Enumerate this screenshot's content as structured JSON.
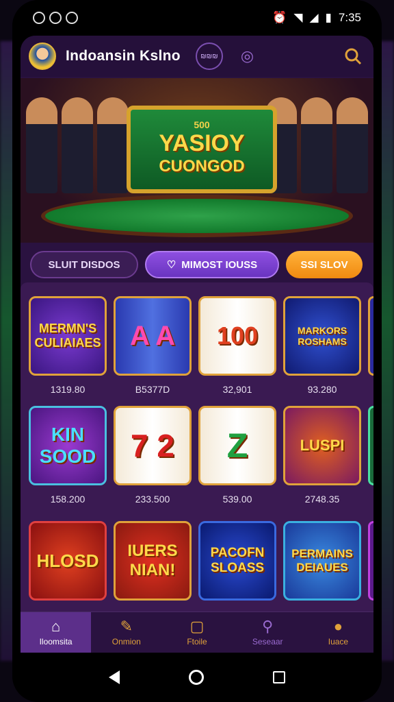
{
  "status": {
    "time": "7:35"
  },
  "app": {
    "title": "Indoansin Kslno",
    "pill_icon_text": "₪₪₪"
  },
  "banner": {
    "line1": "500",
    "line2": "YASIOY",
    "line3": "CUONGOD"
  },
  "tabs": [
    {
      "label": "SLUIT DISDOS"
    },
    {
      "label": "MIMOST IOUSS"
    },
    {
      "label": "SSI SLOV"
    }
  ],
  "games": [
    [
      {
        "name": "MERMN'S CULIAIAES",
        "price": "1319.80"
      },
      {
        "name": "A A",
        "price": "B5377D"
      },
      {
        "name": "100",
        "price": "32,901"
      },
      {
        "name": "MARKORS ROSHAMS",
        "price": "93.280"
      }
    ],
    [
      {
        "name": "KIN SOOD",
        "price": "158.200"
      },
      {
        "name": "7 2",
        "price": "233.500"
      },
      {
        "name": "Z",
        "price": "539.00"
      },
      {
        "name": "LUSPI",
        "price": "2748.35"
      }
    ],
    [
      {
        "name": "HLOSD",
        "price": ""
      },
      {
        "name": "IUERS NIAN!",
        "price": ""
      },
      {
        "name": "PACOFN SLOASS",
        "price": ""
      },
      {
        "name": "PERMAINS DEIAUES",
        "price": ""
      }
    ]
  ],
  "nav": [
    {
      "label": "Iloomsita",
      "icon": "home-icon"
    },
    {
      "label": "Onmion",
      "icon": "microphone-icon"
    },
    {
      "label": "Ftoile",
      "icon": "square-icon"
    },
    {
      "label": "Seseaar",
      "icon": "search-icon"
    },
    {
      "label": "Iuace",
      "icon": "user-icon"
    }
  ],
  "colors": {
    "accent": "#e0a23a",
    "purple": "#8e4fe0",
    "background": "#2a1240"
  }
}
